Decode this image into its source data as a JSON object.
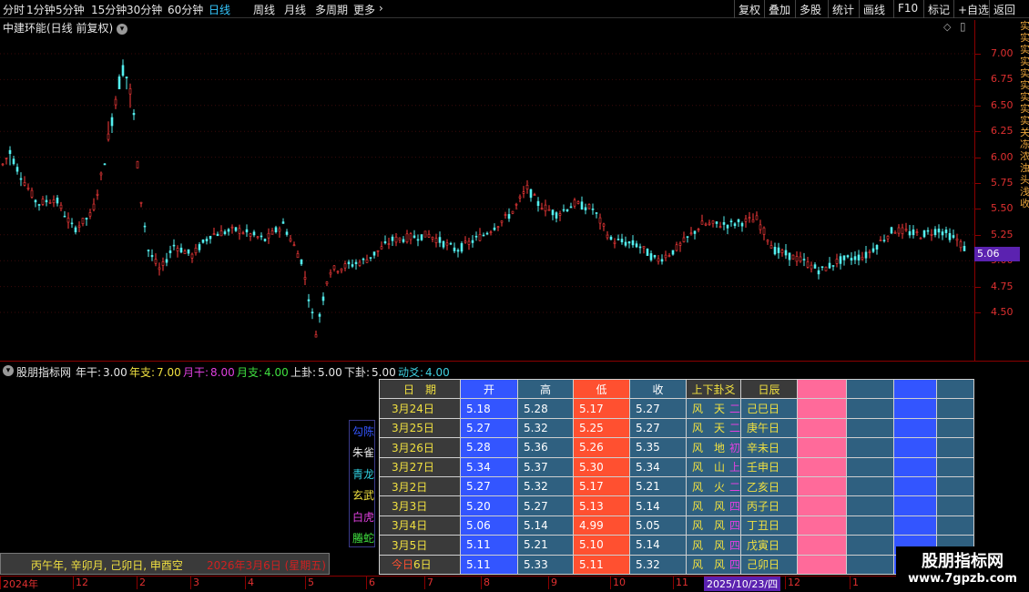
{
  "toolbar": {
    "left_items": [
      "分时",
      "1分钟",
      "5分钟",
      "15分钟",
      "30分钟",
      "60分钟",
      "日线",
      "周线",
      "月线",
      "多周期",
      "更多"
    ],
    "active": "日线",
    "right_items": [
      "复权",
      "叠加",
      "多股",
      "统计",
      "画线",
      "F10",
      "标记",
      "+自选",
      "返回"
    ]
  },
  "chart": {
    "title": "中建环能(日线 前复权)",
    "price_ticks": [
      "7.00",
      "6.75",
      "6.50",
      "6.25",
      "6.00",
      "5.75",
      "5.50",
      "5.25",
      "5.00",
      "4.75",
      "4.50"
    ],
    "current_price": "5.06",
    "side_text": "实实实实实实实实实关冻浓浊头浅收"
  },
  "indicator": {
    "name": "股朋指标网",
    "params": [
      {
        "label": "年干:",
        "value": "3.00",
        "color": "#e6e6e6"
      },
      {
        "label": "年支:",
        "value": "7.00",
        "color": "#f0e040"
      },
      {
        "label": "月干:",
        "value": "8.00",
        "color": "#e040e0"
      },
      {
        "label": "月支:",
        "value": "4.00",
        "color": "#40e040"
      },
      {
        "label": "上卦:",
        "value": "5.00",
        "color": "#e6e6e6"
      },
      {
        "label": "下卦:",
        "value": "5.00",
        "color": "#e6e6e6"
      },
      {
        "label": "动爻:",
        "value": "4.00",
        "color": "#40d0e0"
      }
    ]
  },
  "legend": [
    {
      "label": "勾陈",
      "color": "#3355ff"
    },
    {
      "label": "朱雀",
      "color": "#e6e6e6"
    },
    {
      "label": "青龙",
      "color": "#30d0e0"
    },
    {
      "label": "玄武",
      "color": "#f0e040"
    },
    {
      "label": "白虎",
      "color": "#e040e0"
    },
    {
      "label": "螣蛇",
      "color": "#40e040"
    }
  ],
  "table": {
    "headers": [
      "日　期",
      "开",
      "高",
      "低",
      "收",
      "上下卦爻",
      "日辰"
    ],
    "rows": [
      {
        "date": "3月24日",
        "open": "5.18",
        "high": "5.28",
        "low": "5.17",
        "close": "5.27",
        "gua": "风　天",
        "yao": "二",
        "day": "己巳日"
      },
      {
        "date": "3月25日",
        "open": "5.27",
        "high": "5.32",
        "low": "5.25",
        "close": "5.27",
        "gua": "风　天",
        "yao": "二",
        "day": "庚午日"
      },
      {
        "date": "3月26日",
        "open": "5.28",
        "high": "5.36",
        "low": "5.26",
        "close": "5.35",
        "gua": "风　地",
        "yao": "初",
        "day": "辛未日"
      },
      {
        "date": "3月27日",
        "open": "5.34",
        "high": "5.37",
        "low": "5.30",
        "close": "5.34",
        "gua": "风　山",
        "yao": "上",
        "day": "壬申日"
      },
      {
        "date": "3月2日",
        "open": "5.27",
        "high": "5.32",
        "low": "5.17",
        "close": "5.21",
        "gua": "风　火",
        "yao": "二",
        "day": "乙亥日"
      },
      {
        "date": "3月3日",
        "open": "5.20",
        "high": "5.27",
        "low": "5.13",
        "close": "5.14",
        "gua": "风　风",
        "yao": "四",
        "day": "丙子日"
      },
      {
        "date": "3月4日",
        "open": "5.06",
        "high": "5.14",
        "low": "4.99",
        "close": "5.05",
        "gua": "风　风",
        "yao": "四",
        "day": "丁丑日"
      },
      {
        "date": "3月5日",
        "open": "5.11",
        "high": "5.21",
        "low": "5.10",
        "close": "5.14",
        "gua": "风　风",
        "yao": "四",
        "day": "戊寅日"
      },
      {
        "date_prefix": "今日",
        "date": "6日",
        "open": "5.11",
        "high": "5.33",
        "low": "5.11",
        "close": "5.32",
        "gua": "风　风",
        "yao": "四",
        "day": "己卯日"
      }
    ]
  },
  "info_box": {
    "text1": "丙午年, 辛卯月, 己卯日, 申酉空",
    "text2": "2026年3月6日 (星期五)"
  },
  "date_axis": {
    "labels": [
      "2024年",
      "12",
      "2",
      "3",
      "4",
      "5",
      "6",
      "7",
      "8",
      "9",
      "10",
      "11",
      "12",
      "1"
    ],
    "highlight": "2025/10/23/四"
  },
  "watermark": {
    "title": "股朋指标网",
    "url": "www.7gpzb.com"
  }
}
